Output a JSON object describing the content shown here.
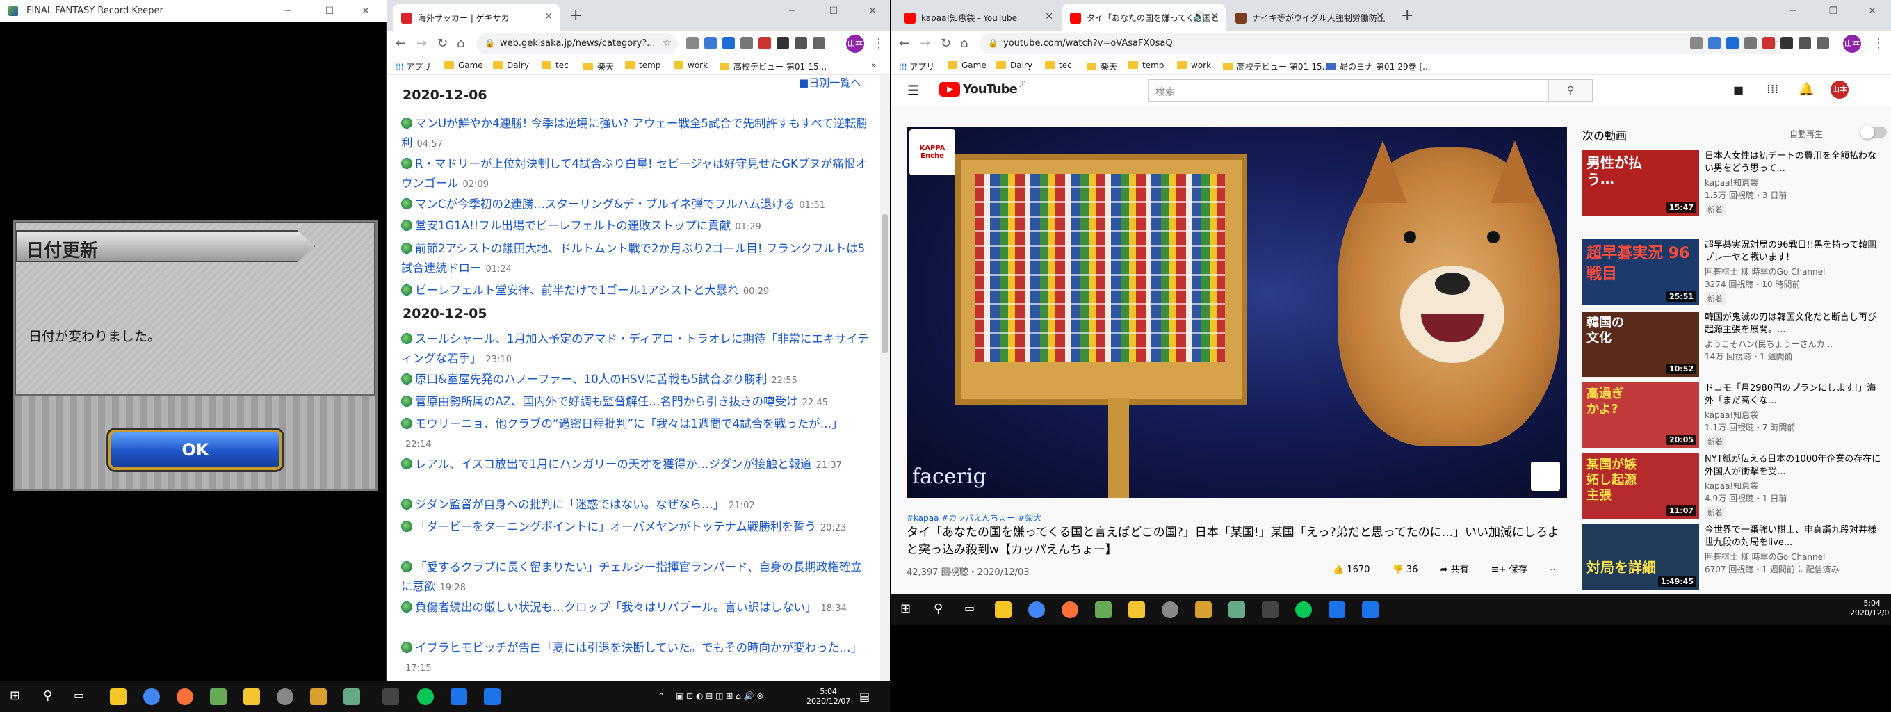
{
  "ffrk": {
    "window_title": "FINAL FANTASY Record Keeper",
    "dialog_title": "日付更新",
    "dialog_message": "日付が変わりました。",
    "ok_label": "OK"
  },
  "gekisaka": {
    "tab_title": "海外サッカー | ゲキサカ",
    "url": "web.gekisaka.jp/news/category?...",
    "list_link": "日別一覧へ",
    "bookmarks": [
      "アプリ",
      "Game",
      "Dairy",
      "tec",
      "楽天",
      "temp",
      "work",
      "高校デビュー 第01-15..."
    ],
    "dates": [
      "2020-12-06",
      "2020-12-05"
    ],
    "items": [
      {
        "title": "マンUが鮮やか4連勝! 今季は逆境に強い? アウェー戦全5試合で先制許すもすべて逆転勝利",
        "time": "04:57"
      },
      {
        "title": "R・マドリーが上位対決制して4試合ぶり白星! セビージャは好守見せたGKブヌが痛恨オウンゴール",
        "time": "02:09"
      },
      {
        "title": "マンCが今季初の2連勝…スターリング&デ・ブルイネ弾でフルハム退ける",
        "time": "01:51"
      },
      {
        "title": "堂安1G1A!!フル出場でビーレフェルトの連敗ストップに貢献",
        "time": "01:29"
      },
      {
        "title": "前節2アシストの鎌田大地、ドルトムント戦で2か月ぶり2ゴール目! フランクフルトは5試合連続ドロー",
        "time": "01:24"
      },
      {
        "title": "ビーレフェルト堂安律、前半だけで1ゴール1アシストと大暴れ",
        "time": "00:29"
      },
      {
        "title": "スールシャール、1月加入予定のアマド・ディアロ・トラオレに期待「非常にエキサイティングな若手」",
        "time": "23:10"
      },
      {
        "title": "原口&室屋先発のハノーファー、10人のHSVに苦戦も5試合ぶり勝利",
        "time": "22:55"
      },
      {
        "title": "菅原由勢所属のAZ、国内外で好調も監督解任…名門から引き抜きの噂受け",
        "time": "22:45"
      },
      {
        "title": "モウリーニョ、他クラブの“過密日程批判”に「我々は1週間で4試合を戦ったが…」",
        "time": "22:14"
      },
      {
        "title": "レアル、イスコ放出で1月にハンガリーの天才を獲得か…ジダンが接触と報道",
        "time": "21:37"
      },
      {
        "title": "ジダン監督が自身への批判に「迷惑ではない。なぜなら…」",
        "time": "21:02"
      },
      {
        "title": "「ダービーをターニングポイントに」オーバメヤンがトッテナム戦勝利を誓う",
        "time": "20:23"
      },
      {
        "title": "「愛するクラブに長く留まりたい」チェルシー指揮官ランパード、自身の長期政権確立に意欲",
        "time": "19:28"
      },
      {
        "title": "負傷者続出の厳しい状況も…クロップ「我々はリバプール。言い訳はしない」",
        "time": "18:34"
      },
      {
        "title": "イブラヒモビッチが告白「夏には引退を決断していた。でもその時向かが変わった…」",
        "time": "17:15"
      }
    ]
  },
  "youtube": {
    "tabs": [
      "kapaa!知恵袋 - YouTube",
      "タイ「あなたの国を嫌ってくる国と",
      "ナイキ等がウイグル人強制労働防止"
    ],
    "url": "youtube.com/watch?v=oVAsaFX0saQ",
    "bookmarks": [
      "アプリ",
      "Game",
      "Dairy",
      "tec",
      "楽天",
      "temp",
      "work",
      "高校デビュー 第01-15...",
      "昴のヨナ 第01-29巻 [..."
    ],
    "logo_text": "YouTube",
    "logo_sup": "JP",
    "search_placeholder": "検索",
    "avatar": "山本",
    "player_logo": "KAPPA Enche",
    "watermark": "facerig",
    "tags": "#kapaa #カッパえんちょー #柴犬",
    "title": "タイ「あなたの国を嫌ってくる国と言えばどこの国?」日本「某国!」某国「えっ?弟だと思ってたのに...」いい加減にしろよと突っ込み殺到w【カッパえんちょー】",
    "meta": "42,397 回視聴・2020/12/03",
    "likes": "1670",
    "dislikes": "36",
    "share": "共有",
    "save": "保存",
    "up_next": "次の動画",
    "autoplay": "自動再生",
    "recs": [
      {
        "title": "日本人女性は初デートの費用を全額払わない男をどう思って...",
        "channel": "kapaa!知恵袋",
        "views": "1.5万 回視聴・3 日前",
        "badge": "新着",
        "duration": "15:47",
        "thumb_text": "男性が払う…",
        "color": "#b32020"
      },
      {
        "title": "超早碁実況対局の96戦目!!黒を持って韓国プレーヤと戦います!",
        "channel": "囲碁棋士 柳 時熏のGo Channel",
        "views": "3274 回視聴・10 時間前",
        "badge": "新着",
        "duration": "25:51",
        "thumb_text": "超早碁実況 96戦目",
        "color": "#1b3a6b"
      },
      {
        "title": "韓国が鬼滅の刃は韓国文化だと断言し再び起源主張を展開。...",
        "channel": "ようこそハン(民ちょうーさんカ...",
        "views": "14万 回視聴・1 週間前",
        "badge": "",
        "duration": "10:52",
        "thumb_text": "韓国の文化",
        "color": "#5a2a1a"
      },
      {
        "title": "ドコモ「月2980円のプランにします!」海外「まだ高くな...",
        "channel": "kapaa!知恵袋",
        "views": "1.1万 回視聴・7 時間前",
        "badge": "新着",
        "duration": "20:05",
        "thumb_text": "高過ぎかよ?",
        "color": "#c23b3b"
      },
      {
        "title": "NYT紙が伝える日本の1000年企業の存在に外国人が衝撃を受...",
        "channel": "kapaa!知恵袋",
        "views": "4.9万 回視聴・1 日前",
        "badge": "新着",
        "duration": "11:07",
        "thumb_text": "某国が嫉妬し起源主張",
        "color": "#b52a2a"
      },
      {
        "title": "今世界で一番強い棋士、申真諝九段対井様世九段の対局をlive...",
        "channel": "囲碁棋士 柳 時熏のGo Channel",
        "views": "6707 回視聴・1 週間前 に配信済み",
        "badge": "",
        "duration": "1:49:45",
        "thumb_text": "対局を詳細",
        "color": "#203a5a"
      }
    ]
  },
  "taskbar": {
    "time": "5:04",
    "date": "2020/12/07"
  }
}
